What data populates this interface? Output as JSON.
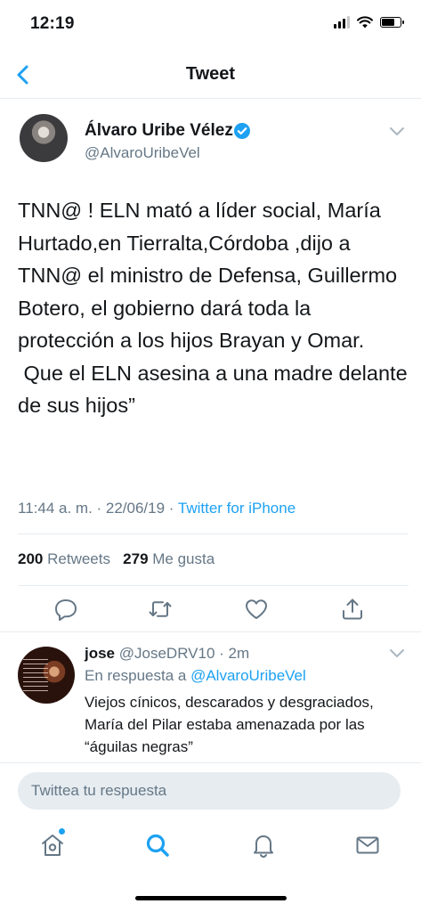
{
  "status_bar": {
    "time": "12:19",
    "battery_level": 0.75
  },
  "nav": {
    "title": "Tweet",
    "back_icon": "chevron-left-icon"
  },
  "tweet": {
    "author_name": "Álvaro Uribe Vélez",
    "author_handle": "@AlvaroUribeVel",
    "verified": true,
    "text": "TNN@ ! ELN mató a líder social, María Hurtado,en Tierralta,Córdoba ,dijo a TNN@ el ministro de Defensa, Guillermo Botero, el gobierno dará toda la protección a los hijos Brayan y Omar.\n Que el ELN asesina a una madre delante de sus hijos”",
    "timestamp": "11:44 a. m. · 22/06/19 · ",
    "source": "Twitter for iPhone",
    "retweets_count": "200",
    "retweets_label": "Retweets",
    "likes_count": "279",
    "likes_label": "Me gusta"
  },
  "actions": [
    "reply-icon",
    "retweet-icon",
    "like-icon",
    "share-icon"
  ],
  "reply": {
    "name": "jose",
    "handle": "@JoseDRV10 · 2m",
    "in_reply_prefix": "En respuesta a ",
    "in_reply_mention": "@AlvaroUribeVel",
    "text": "Viejos cínicos, descarados y desgraciados, María del Pilar estaba amenazada por las “águilas negras”"
  },
  "compose": {
    "placeholder": "Twittea tu respuesta"
  },
  "tab_bar": [
    "home-icon",
    "search-icon",
    "notifications-icon",
    "messages-icon"
  ],
  "colors": {
    "accent": "#1da1f2",
    "secondary_text": "#657786",
    "divider": "#e6ecf0"
  }
}
